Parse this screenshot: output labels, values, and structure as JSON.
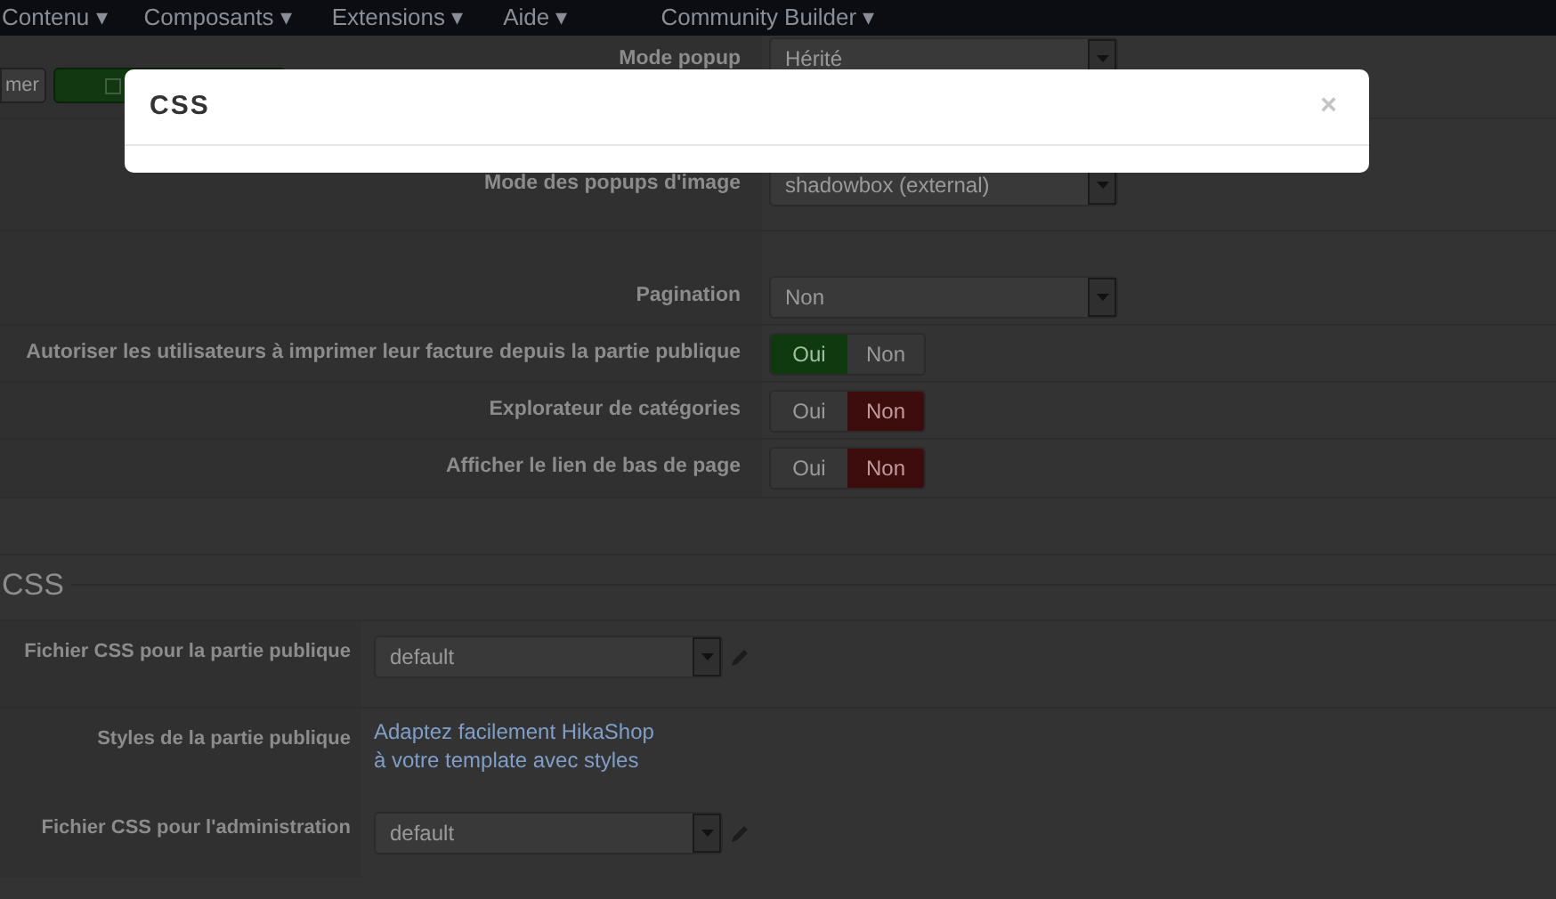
{
  "navbar": {
    "items": [
      {
        "label": "Contenu ▾"
      },
      {
        "label": "Composants ▾"
      },
      {
        "label": "Extensions ▾"
      },
      {
        "label": "Aide ▾"
      },
      {
        "label": "Community Builder ▾"
      }
    ]
  },
  "toolbar": {
    "buttons": [
      {
        "kind": "default",
        "label": "mer"
      },
      {
        "kind": "success"
      }
    ]
  },
  "settings": [
    {
      "label": "Mode popup",
      "kind": "select",
      "value": "Hérité"
    },
    {
      "label": "Mode des popups d'image",
      "kind": "select",
      "value": "shadowbox (external)"
    },
    {
      "label": "Pagination",
      "kind": "select",
      "value": "Non"
    },
    {
      "label": "Autoriser les utilisateurs à imprimer leur facture depuis la partie publique",
      "kind": "toggle",
      "options": [
        {
          "label": "Oui",
          "kind": "yes",
          "selected": true
        },
        {
          "label": "Non",
          "kind": "no",
          "selected": false
        }
      ]
    },
    {
      "label": "Explorateur de catégories",
      "kind": "toggle",
      "options": [
        {
          "label": "Oui",
          "kind": "yes",
          "selected": false
        },
        {
          "label": "Non",
          "kind": "no",
          "selected": true
        }
      ]
    },
    {
      "label": "Afficher le lien de bas de page",
      "kind": "toggle",
      "options": [
        {
          "label": "Oui",
          "kind": "yes",
          "selected": false
        },
        {
          "label": "Non",
          "kind": "no",
          "selected": true
        }
      ]
    }
  ],
  "css_section": {
    "title": "CSS",
    "rows": [
      {
        "label": "Fichier CSS pour la partie publique",
        "kind": "select",
        "value": "default",
        "editable": true
      },
      {
        "label": "Styles de la partie publique",
        "kind": "link",
        "lines": [
          "Adaptez facilement HikaShop",
          "à votre template avec styles"
        ]
      },
      {
        "label": "Fichier CSS pour l'administration",
        "kind": "select",
        "value": "default",
        "editable": true
      }
    ]
  },
  "modal": {
    "title": "CSS",
    "close": "×"
  }
}
